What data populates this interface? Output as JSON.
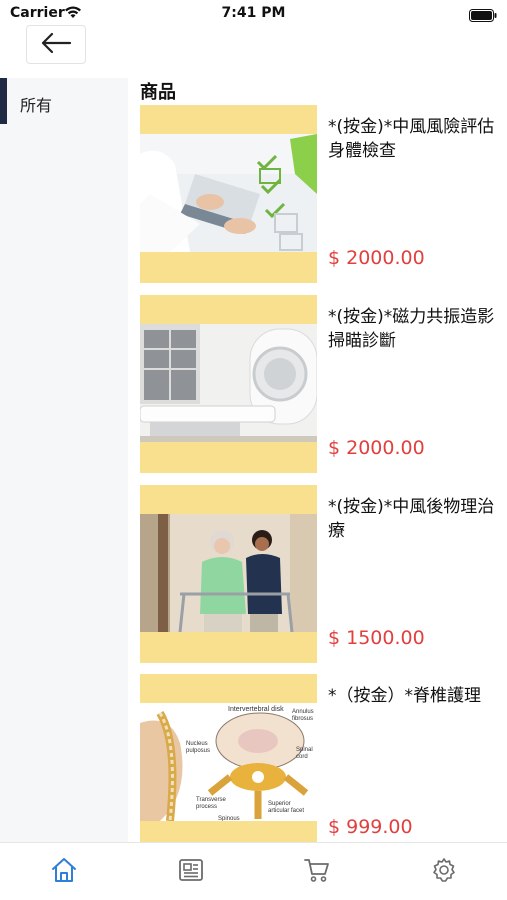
{
  "status_bar": {
    "carrier": "Carrier",
    "time": "7:41 PM",
    "icons": [
      "wifi-icon",
      "battery-icon"
    ]
  },
  "header": {
    "back_icon": "arrow-left-icon"
  },
  "sidebar": {
    "items": [
      {
        "label": "所有",
        "selected": true
      }
    ]
  },
  "main": {
    "section_title": "商品",
    "products": [
      {
        "title": "*(按金)*中風風險評估 身體檢查",
        "price": "$ 2000.00",
        "image": "doctor-with-checklist"
      },
      {
        "title": "*(按金)*磁力共振造影掃瞄診斷",
        "price": "$ 2000.00",
        "image": "mri-scanner"
      },
      {
        "title": "*(按金)*中風後物理治療",
        "price": "$ 1500.00",
        "image": "physiotherapy-walker"
      },
      {
        "title": "*（按金）*脊椎護理",
        "price": "$ 999.00",
        "image": "spine-anatomy-diagram"
      }
    ]
  },
  "tab_bar": {
    "tabs": [
      {
        "icon": "home-icon",
        "active": true
      },
      {
        "icon": "news-icon",
        "active": false
      },
      {
        "icon": "cart-icon",
        "active": false
      },
      {
        "icon": "settings-icon",
        "active": false
      }
    ]
  },
  "colors": {
    "accent": "#2f7fd6",
    "price": "#e0403e",
    "thumbnail_bg": "#f8e08e",
    "sidebar_bg": "#f6f7f9",
    "sidebar_indicator": "#1f2a44"
  }
}
